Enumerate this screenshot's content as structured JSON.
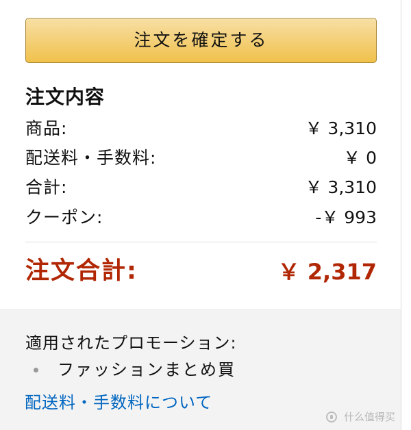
{
  "actions": {
    "place_order_label": "注文を確定する"
  },
  "order_summary": {
    "title": "注文内容",
    "rows": [
      {
        "label": "商品:",
        "value": "￥ 3,310"
      },
      {
        "label": "配送料・手数料:",
        "value": "￥ 0"
      },
      {
        "label": "合計:",
        "value": "￥ 3,310"
      },
      {
        "label": "クーポン:",
        "value": "-￥ 993"
      }
    ],
    "total": {
      "label": "注文合計:",
      "value": "￥ 2,317"
    }
  },
  "promotions": {
    "heading": "適用されたプロモーション:",
    "items": [
      "ファッションまとめ買"
    ],
    "shipping_link": "配送料・手数料について"
  },
  "watermark": {
    "text": "什么值得买",
    "icon": "watermark-logo-icon"
  },
  "colors": {
    "button": "#f0c14b",
    "total": "#b12704",
    "link": "#0066c0",
    "promotion_background": "#f3f3f3"
  }
}
